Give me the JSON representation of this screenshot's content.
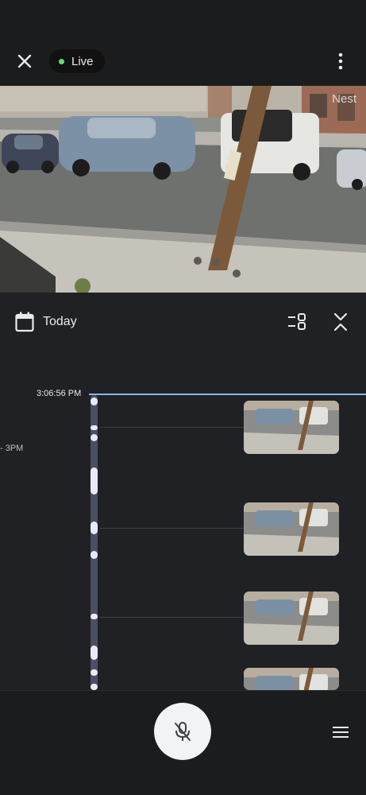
{
  "header": {
    "close_icon": "close-icon",
    "live_label": "Live",
    "live_dot_color": "#5ce06b",
    "more_icon": "more-vert-icon"
  },
  "camera": {
    "watermark": "Nest"
  },
  "date_row": {
    "calendar_icon": "calendar-icon",
    "date_label": "Today",
    "filter_icon": "filter-icon",
    "collapse_icon": "collapse-icon"
  },
  "timeline": {
    "current_time": "3:06:56 PM",
    "hour_marker": "- 3PM",
    "now_line_color": "#8ab4f8",
    "event_thumbnails": [
      "event-clip-1",
      "event-clip-2",
      "event-clip-3",
      "event-clip-4"
    ]
  },
  "footer": {
    "mic_icon": "mic-off-icon",
    "menu_icon": "menu-icon"
  }
}
